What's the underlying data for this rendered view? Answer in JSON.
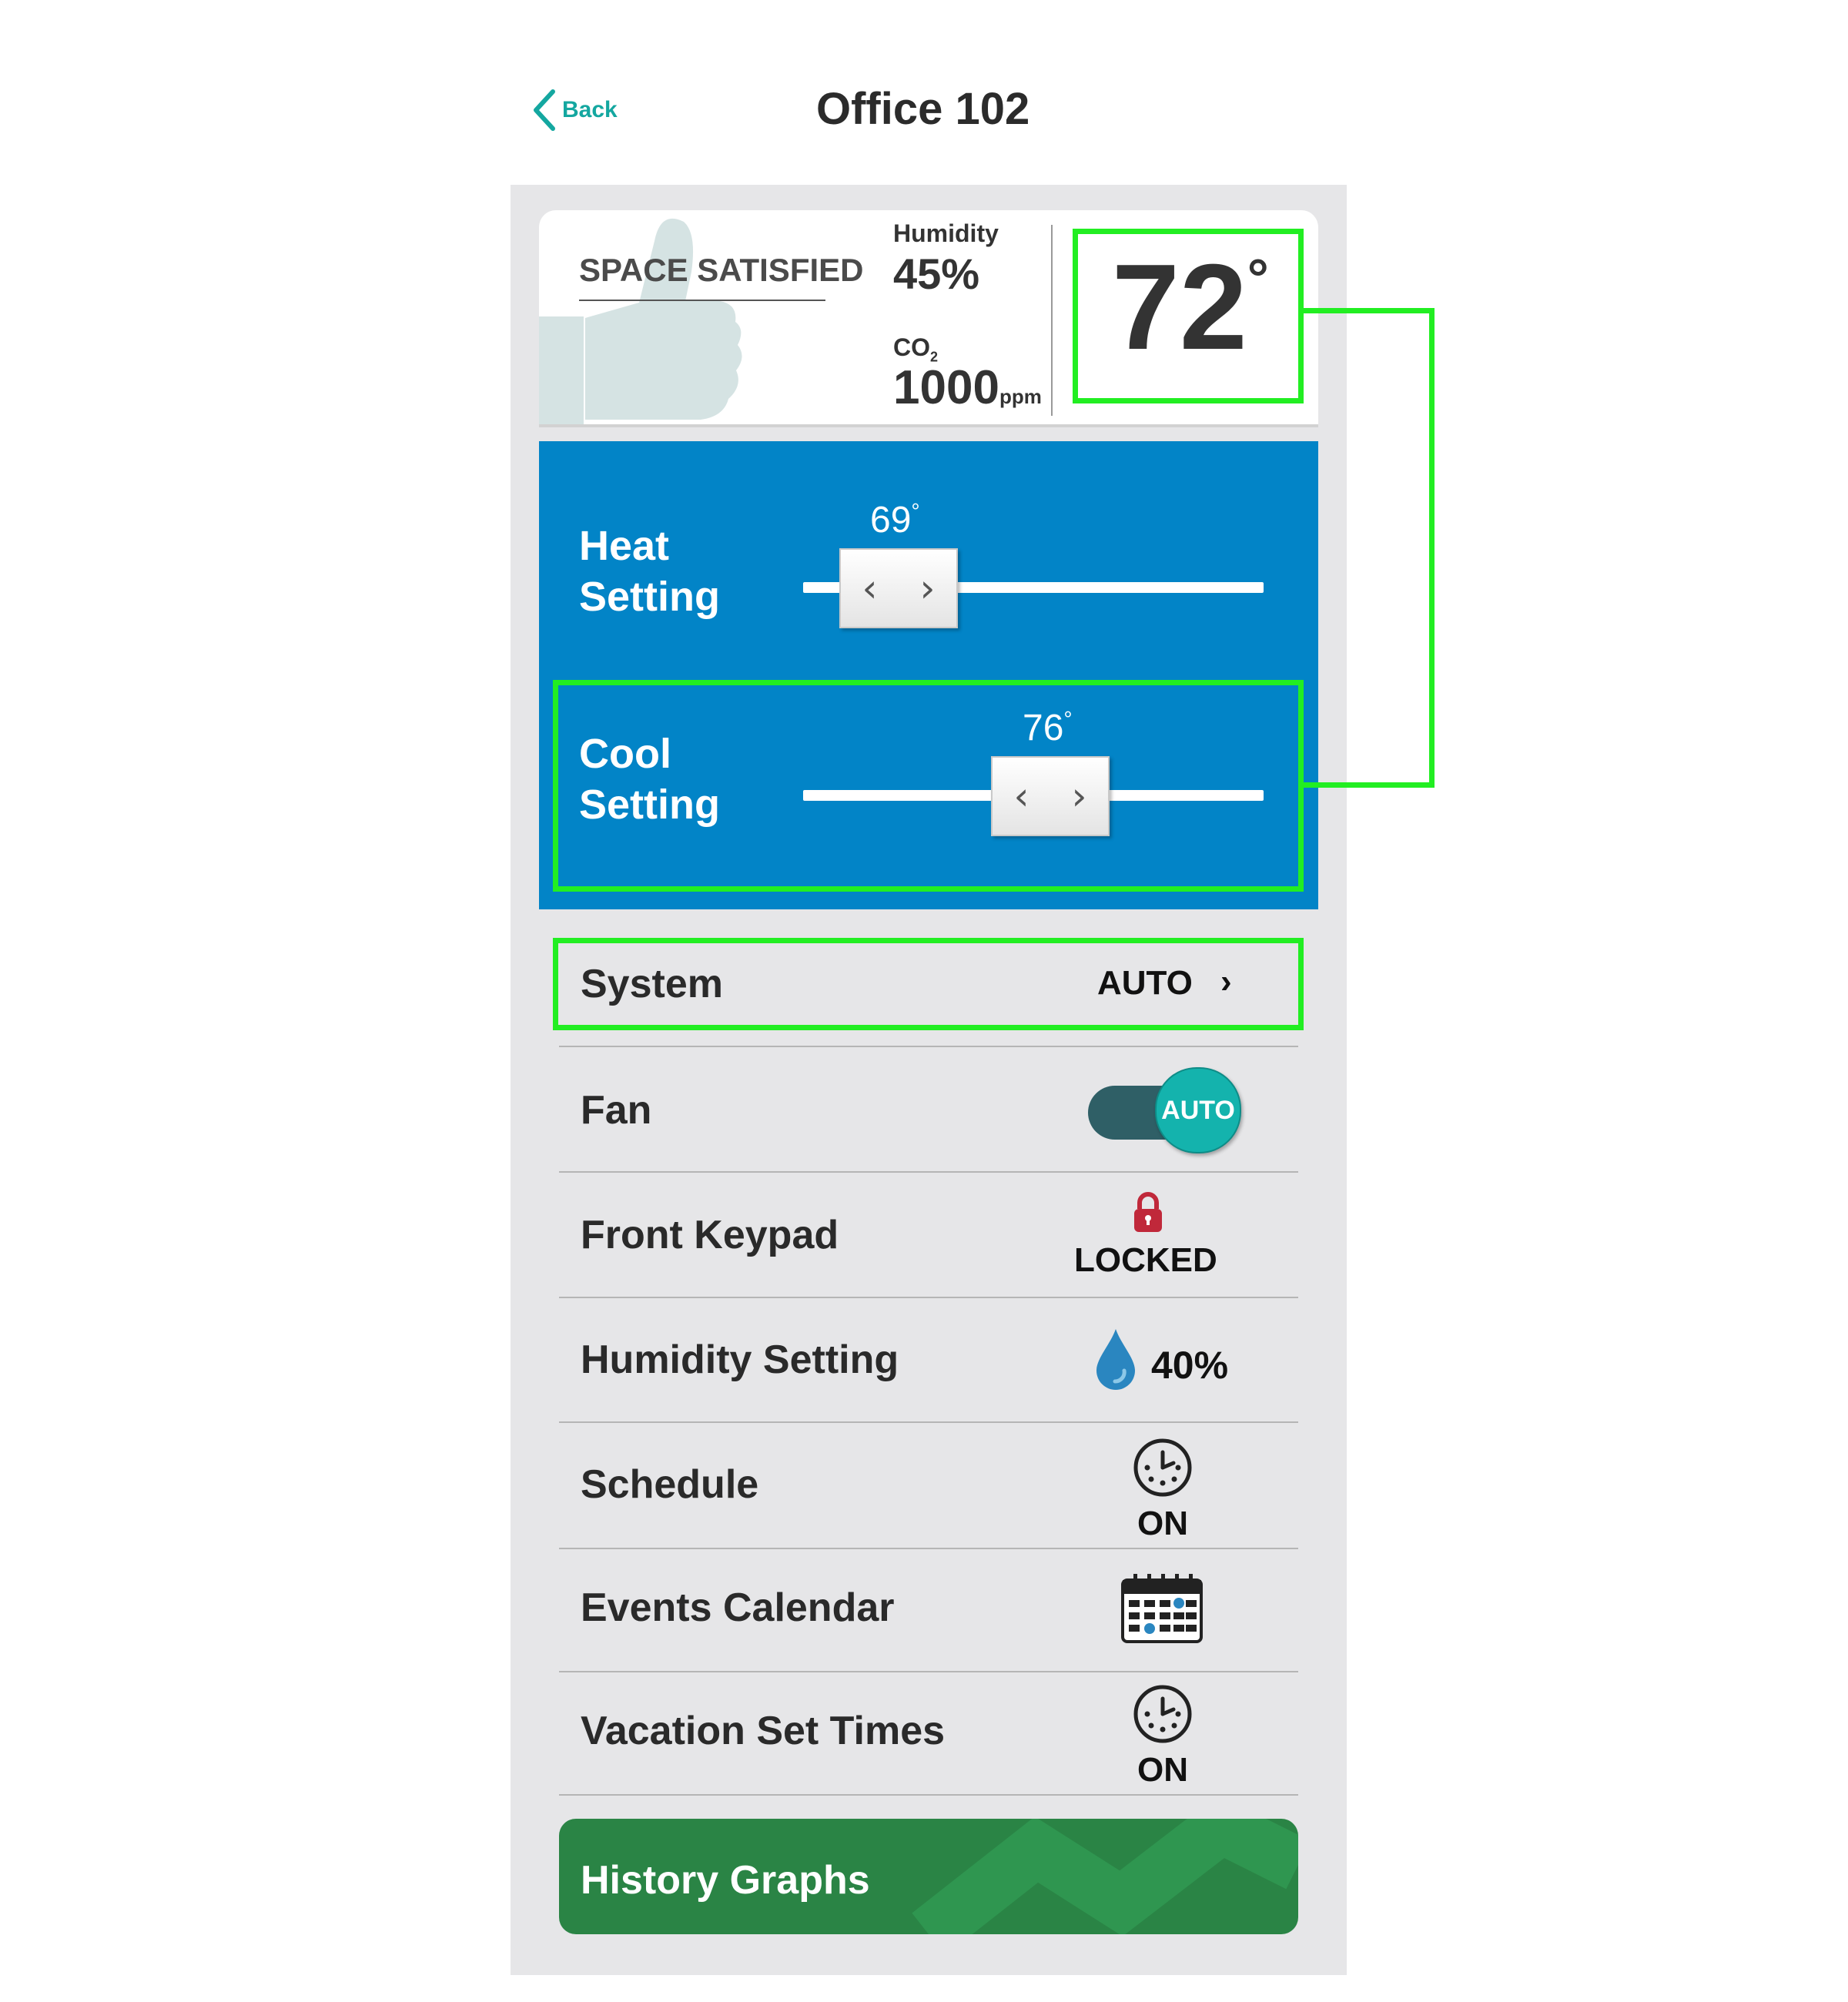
{
  "header": {
    "back_label": "Back",
    "title": "Office 102"
  },
  "status_card": {
    "space_status": "SPACE SATISFIED",
    "humidity_label": "Humidity",
    "humidity_value": "45%",
    "co2_label": "CO",
    "co2_subscript": "2",
    "co2_value": "1000",
    "co2_unit": "ppm",
    "temperature": "72",
    "temperature_degree": "°"
  },
  "settings": {
    "heat": {
      "label_line1": "Heat",
      "label_line2": "Setting",
      "value": "69",
      "degree": "°"
    },
    "cool": {
      "label_line1": "Cool",
      "label_line2": "Setting",
      "value": "76",
      "degree": "°"
    }
  },
  "rows": {
    "system": {
      "label": "System",
      "value": "AUTO",
      "chevron": "›"
    },
    "fan": {
      "label": "Fan",
      "value": "AUTO"
    },
    "front_keypad": {
      "label": "Front Keypad",
      "value": "LOCKED",
      "icon": "lock-icon"
    },
    "humidity_setting": {
      "label": "Humidity Setting",
      "value": "40%",
      "icon": "water-drop-icon"
    },
    "schedule": {
      "label": "Schedule",
      "value": "ON",
      "icon": "clock-icon"
    },
    "events_calendar": {
      "label": "Events Calendar",
      "icon": "calendar-icon"
    },
    "vacation": {
      "label": "Vacation Set Times",
      "value": "ON",
      "icon": "clock-icon"
    }
  },
  "history": {
    "label": "History Graphs"
  },
  "colors": {
    "accent_teal": "#14a7a0",
    "settings_blue": "#0284c7",
    "highlight_green": "#22ee22",
    "history_green": "#2a8445",
    "lock_red": "#c0283a",
    "drop_blue": "#2a86c0"
  }
}
